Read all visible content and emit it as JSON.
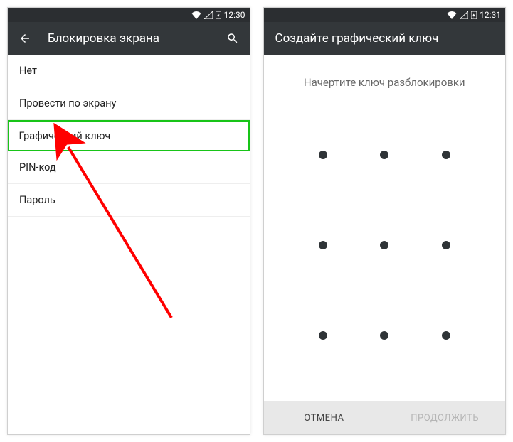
{
  "left": {
    "status": {
      "time": "12:30"
    },
    "appbar": {
      "title": "Блокировка экрана"
    },
    "items": [
      {
        "label": "Нет",
        "highlight": false
      },
      {
        "label": "Провести по экрану",
        "highlight": false
      },
      {
        "label": "Графический ключ",
        "highlight": true
      },
      {
        "label": "PIN-код",
        "highlight": false
      },
      {
        "label": "Пароль",
        "highlight": false
      }
    ]
  },
  "right": {
    "status": {
      "time": "12:31"
    },
    "appbar": {
      "title": "Создайте графический ключ"
    },
    "subtitle": "Начертите ключ разблокировки",
    "buttons": {
      "cancel": "ОТМЕНА",
      "continue": "ПРОДОЛЖИТЬ"
    }
  }
}
